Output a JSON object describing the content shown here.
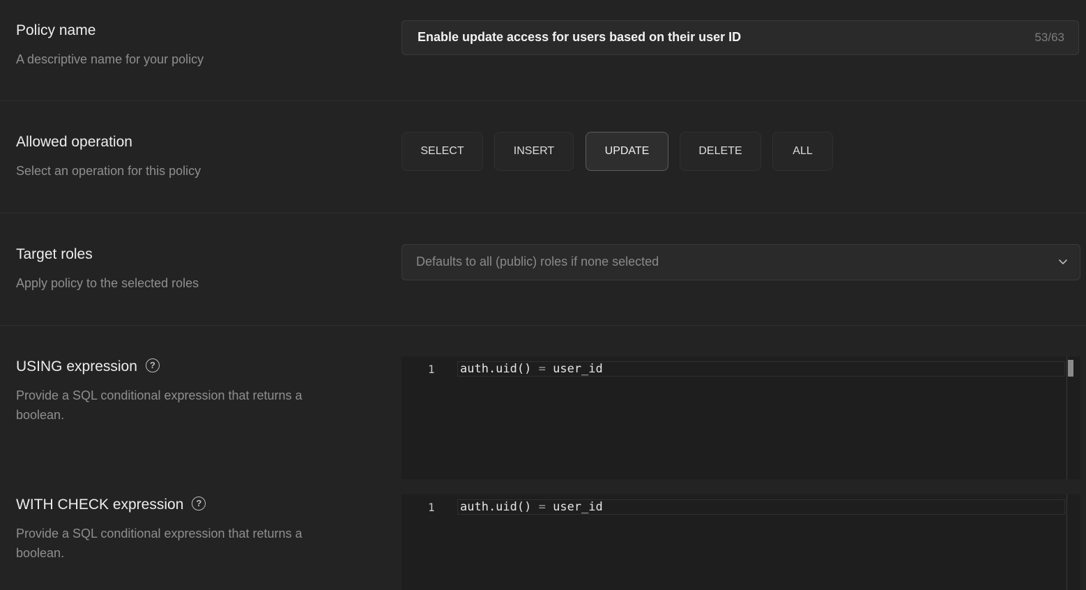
{
  "policy_name": {
    "title": "Policy name",
    "description": "A descriptive name for your policy",
    "value": "Enable update access for users based on their user ID",
    "counter": "53/63"
  },
  "allowed_operation": {
    "title": "Allowed operation",
    "description": "Select an operation for this policy",
    "options": [
      "SELECT",
      "INSERT",
      "UPDATE",
      "DELETE",
      "ALL"
    ],
    "selected": "UPDATE"
  },
  "target_roles": {
    "title": "Target roles",
    "description": "Apply policy to the selected roles",
    "placeholder": "Defaults to all (public) roles if none selected"
  },
  "using_expression": {
    "title": "USING expression",
    "help_icon": "?",
    "description": "Provide a SQL conditional expression that returns a boolean.",
    "line_number": "1",
    "code_left": "auth.uid()",
    "code_op": "=",
    "code_right": "user_id"
  },
  "with_check_expression": {
    "title": "WITH CHECK expression",
    "help_icon": "?",
    "description": "Provide a SQL conditional expression that returns a boolean.",
    "line_number": "1",
    "code_left": "auth.uid()",
    "code_op": "=",
    "code_right": "user_id"
  }
}
